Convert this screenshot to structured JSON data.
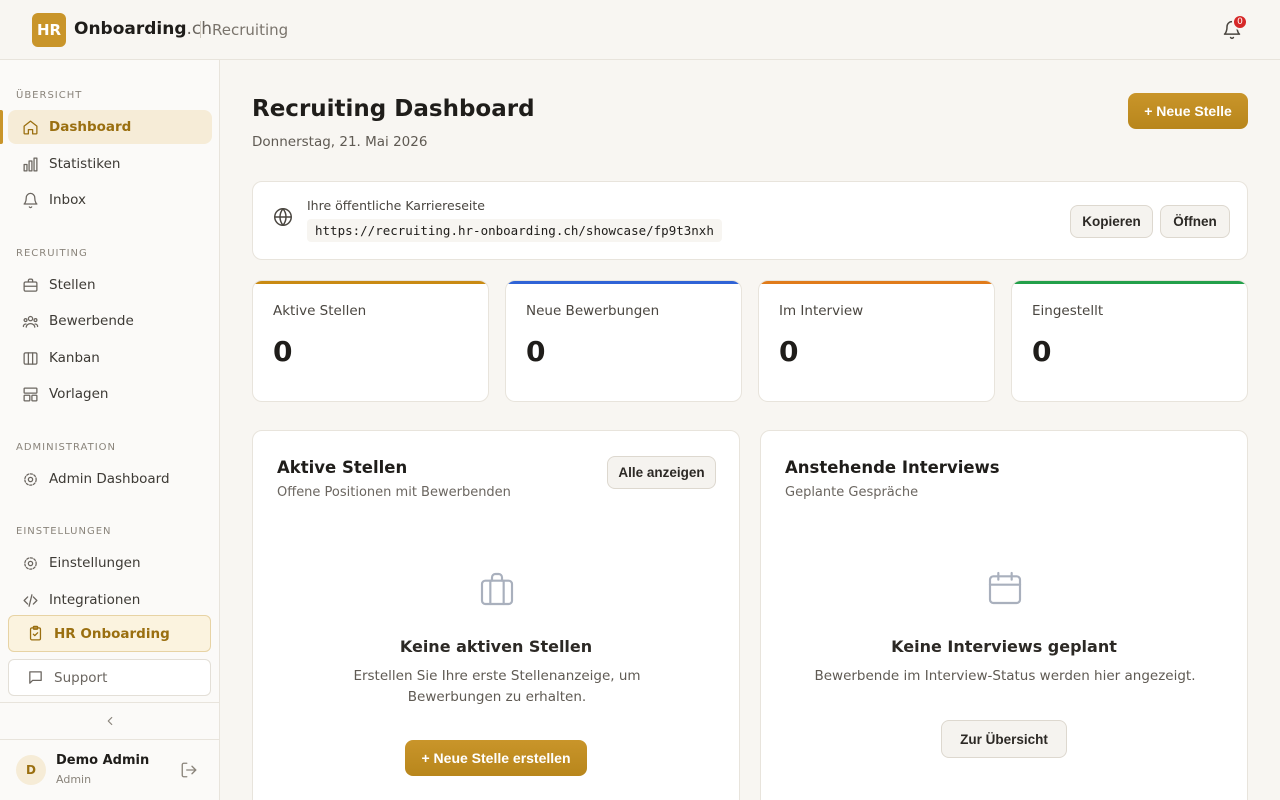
{
  "brand": {
    "badge": "HR",
    "name": "Onboarding",
    "suffix": ".ch",
    "section": "Recruiting"
  },
  "notifications": {
    "count": "0"
  },
  "sidebar": {
    "sections": {
      "overview": "ÜBERSICHT",
      "recruiting": "RECRUITING",
      "administration": "ADMINISTRATION",
      "settings": "EINSTELLUNGEN"
    },
    "items": {
      "dashboard": "Dashboard",
      "statistics": "Statistiken",
      "inbox": "Inbox",
      "jobs": "Stellen",
      "applicants": "Bewerbende",
      "kanban": "Kanban",
      "templates": "Vorlagen",
      "admin_dashboard": "Admin Dashboard",
      "settings": "Einstellungen",
      "integrations": "Integrationen",
      "hr_onboarding": "HR Onboarding",
      "support": "Support"
    },
    "user": {
      "initial": "D",
      "name": "Demo Admin",
      "role": "Admin"
    }
  },
  "header": {
    "title": "Recruiting Dashboard",
    "date": "Donnerstag, 21. Mai 2026",
    "new_job_button": "+ Neue Stelle"
  },
  "career": {
    "label": "Ihre öffentliche Karriereseite",
    "url": "https://recruiting.hr-onboarding.ch/showcase/fp9t3nxh",
    "copy_button": "Kopieren",
    "open_button": "Öffnen"
  },
  "stats": [
    {
      "label": "Aktive Stellen",
      "value": "0",
      "color": "#c98a12"
    },
    {
      "label": "Neue Bewerbungen",
      "value": "0",
      "color": "#2f63d6"
    },
    {
      "label": "Im Interview",
      "value": "0",
      "color": "#e07b1a"
    },
    {
      "label": "Eingestellt",
      "value": "0",
      "color": "#23a04a"
    }
  ],
  "active_jobs": {
    "title": "Aktive Stellen",
    "subtitle": "Offene Positionen mit Bewerbenden",
    "show_all_button": "Alle anzeigen",
    "empty_title": "Keine aktiven Stellen",
    "empty_text": "Erstellen Sie Ihre erste Stellenanzeige, um Bewerbungen zu erhalten.",
    "create_button": "+ Neue Stelle erstellen"
  },
  "interviews": {
    "title": "Anstehende Interviews",
    "subtitle": "Geplante Gespräche",
    "empty_title": "Keine Interviews geplant",
    "empty_text": "Bewerbende im Interview-Status werden hier angezeigt.",
    "overview_button": "Zur Übersicht"
  }
}
